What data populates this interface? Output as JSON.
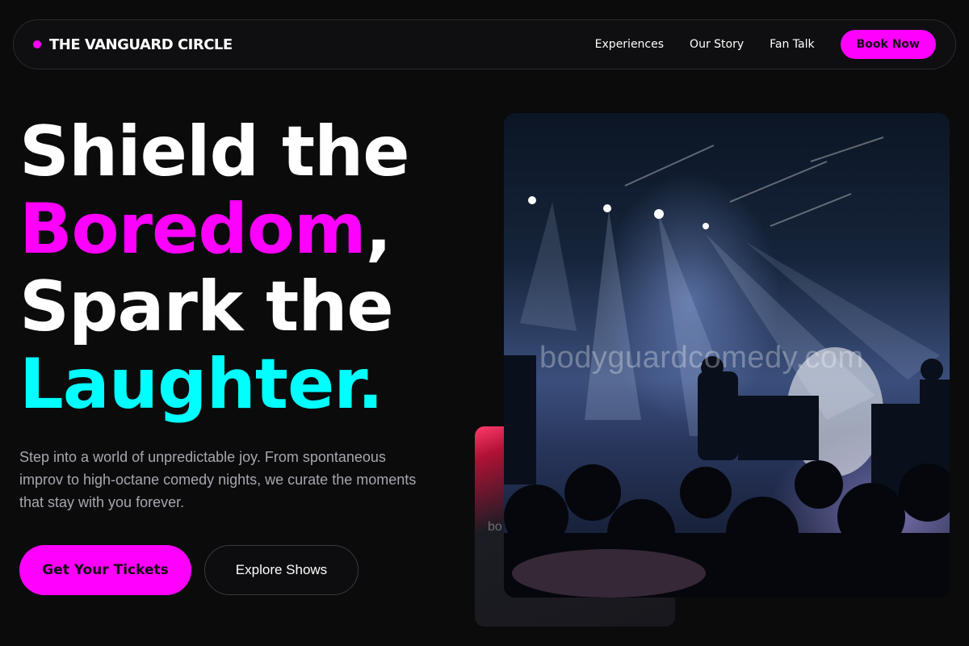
{
  "brand": {
    "name": "THE VANGUARD CIRCLE",
    "accent": "#ff00ff"
  },
  "nav": {
    "links": [
      "Experiences",
      "Our Story",
      "Fan Talk"
    ],
    "cta": "Book Now"
  },
  "hero": {
    "line1": "Shield the",
    "line2_highlight": "Boredom",
    "line2_rest": ",",
    "line3": "Spark the",
    "line4": "Laughter.",
    "subtitle": "Step into a world of unpredictable joy. From spontaneous improv to high-octane comedy nights, we curate the moments that stay with you forever.",
    "primary_cta": "Get Your Tickets",
    "secondary_cta": "Explore Shows"
  },
  "media": {
    "watermark": "bodyguardcomedy.com",
    "back_watermark": "bo"
  },
  "colors": {
    "pink": "#ff00ff",
    "cyan": "#00ffff",
    "background": "#0b0b0c"
  }
}
